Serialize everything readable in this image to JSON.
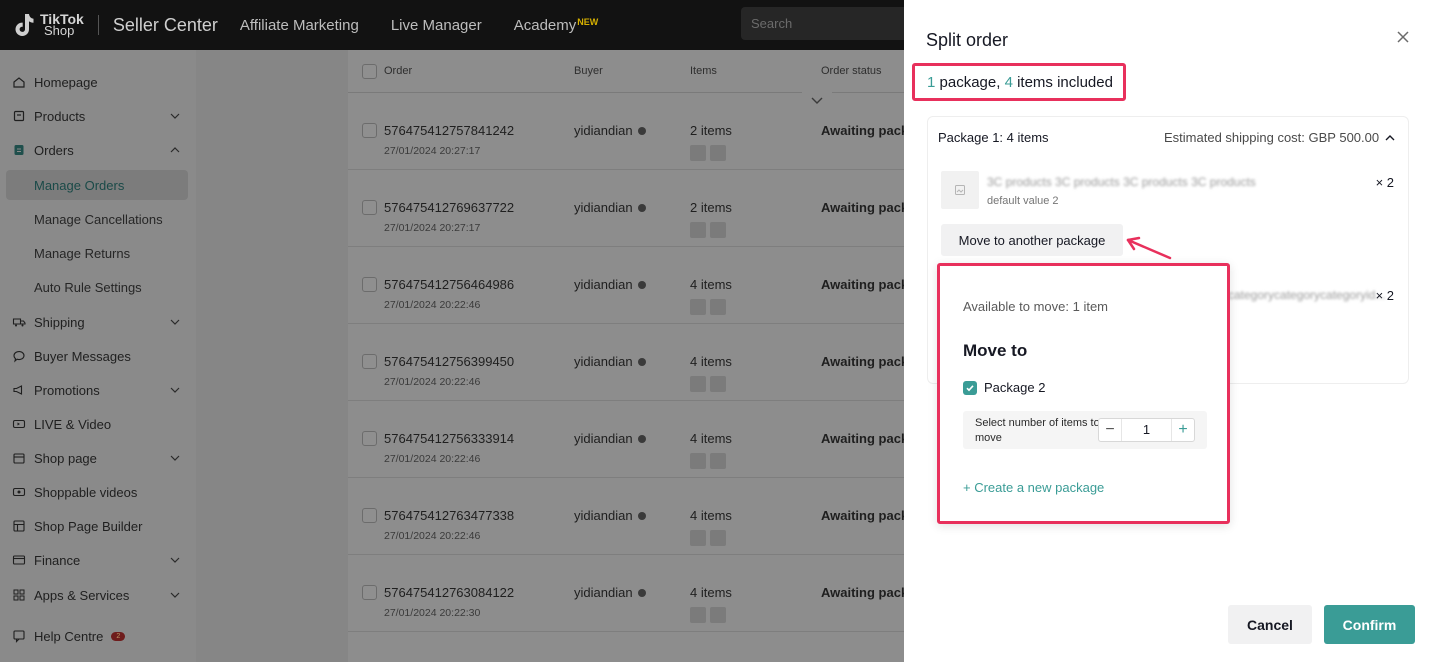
{
  "topbar": {
    "logo_line1": "TikTok",
    "logo_line2": "Shop",
    "app_title": "Seller Center",
    "nav": [
      "Affiliate Marketing",
      "Live Manager",
      "Academy"
    ],
    "academy_badge": "NEW",
    "search_placeholder": "Search"
  },
  "sidebar": {
    "items": [
      {
        "label": "Homepage",
        "icon": "home-icon",
        "has_chevron": false
      },
      {
        "label": "Products",
        "icon": "box-icon",
        "has_chevron": true
      },
      {
        "label": "Orders",
        "icon": "orders-icon",
        "has_chevron": true,
        "expanded": true
      },
      {
        "label": "Shipping",
        "icon": "truck-icon",
        "has_chevron": true
      },
      {
        "label": "Buyer Messages",
        "icon": "chat-icon",
        "has_chevron": false
      },
      {
        "label": "Promotions",
        "icon": "megaphone-icon",
        "has_chevron": true
      },
      {
        "label": "LIVE & Video",
        "icon": "live-icon",
        "has_chevron": false
      },
      {
        "label": "Shop page",
        "icon": "store-icon",
        "has_chevron": true
      },
      {
        "label": "Shoppable videos",
        "icon": "video-icon",
        "has_chevron": false
      },
      {
        "label": "Shop Page Builder",
        "icon": "builder-icon",
        "has_chevron": false
      },
      {
        "label": "Finance",
        "icon": "wallet-icon",
        "has_chevron": true
      },
      {
        "label": "Apps & Services",
        "icon": "apps-icon",
        "has_chevron": true
      },
      {
        "label": "Help Centre",
        "icon": "help-icon",
        "has_chevron": false
      }
    ],
    "order_subitems": [
      "Manage Orders",
      "Manage Cancellations",
      "Manage Returns",
      "Auto Rule Settings"
    ],
    "active_subitem": "Manage Orders",
    "help_badge": "2"
  },
  "table": {
    "headers": {
      "order": "Order",
      "buyer": "Buyer",
      "items": "Items",
      "status": "Order status"
    },
    "rows": [
      {
        "order_id": "576475412757841242",
        "date": "27/01/2024 20:27:17",
        "buyer": "yidiandian",
        "items": "2 items",
        "thumbs": 2,
        "status": "Awaiting pack"
      },
      {
        "order_id": "576475412769637722",
        "date": "27/01/2024 20:27:17",
        "buyer": "yidiandian",
        "items": "2 items",
        "thumbs": 2,
        "status": "Awaiting pack"
      },
      {
        "order_id": "576475412756464986",
        "date": "27/01/2024 20:22:46",
        "buyer": "yidiandian",
        "items": "4 items",
        "thumbs": 2,
        "status": "Awaiting pack"
      },
      {
        "order_id": "576475412756399450",
        "date": "27/01/2024 20:22:46",
        "buyer": "yidiandian",
        "items": "4 items",
        "thumbs": 2,
        "status": "Awaiting pack"
      },
      {
        "order_id": "576475412756333914",
        "date": "27/01/2024 20:22:46",
        "buyer": "yidiandian",
        "items": "4 items",
        "thumbs": 2,
        "status": "Awaiting pack"
      },
      {
        "order_id": "576475412763477338",
        "date": "27/01/2024 20:22:46",
        "buyer": "yidiandian",
        "items": "4 items",
        "thumbs": 2,
        "status": "Awaiting pack"
      },
      {
        "order_id": "576475412763084122",
        "date": "27/01/2024 20:22:30",
        "buyer": "yidiandian",
        "items": "4 items",
        "thumbs": 2,
        "status": "Awaiting pack"
      }
    ]
  },
  "drawer": {
    "title": "Split order",
    "summary": {
      "package_count": "1",
      "package_text": " package, ",
      "item_count": "4",
      "item_text": " items included"
    },
    "package": {
      "title": "Package 1: 4 items",
      "shipping": "Estimated shipping cost: GBP 500.00",
      "products": [
        {
          "name": "3C products 3C products 3C products 3C products",
          "variant": "default value 2",
          "qty": "× 2"
        },
        {
          "name": "categorycategorycategoryid...",
          "variant": "",
          "qty": "× 2"
        }
      ],
      "move_button": "Move to another package"
    },
    "popover": {
      "available": "Available to move: 1 item",
      "move_to": "Move to",
      "target_package": "Package 2",
      "target_checked": true,
      "qty_label": "Select number of items to move",
      "qty_value": "1",
      "create_link": "+ Create a new package"
    },
    "cancel": "Cancel",
    "confirm": "Confirm"
  },
  "colors": {
    "accent": "#3a9c96",
    "highlight": "#e8305c",
    "topbar": "#121212"
  }
}
